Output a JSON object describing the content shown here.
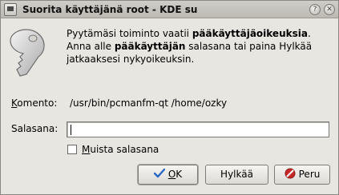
{
  "window": {
    "title": "Suorita käyttäjänä root - KDE su"
  },
  "titlebar": {
    "help_glyph": "?",
    "close_glyph": "✕"
  },
  "message": {
    "line1_pre": "Pyytämäsi toiminto vaatii ",
    "line1_bold": "pääkäyttäjäoikeuksia",
    "line1_post": ".",
    "line2_pre": "Anna alle ",
    "line2_bold": "pääkäyttäjän",
    "line2_post": " salasana tai paina Hylkää",
    "line3": "jatkaaksesi nykyoikeuksin."
  },
  "command": {
    "label_accel": "K",
    "label_rest": "omento:",
    "value": "/usr/bin/pcmanfm-qt /home/ozky"
  },
  "password": {
    "label": "Salasana:",
    "value": ""
  },
  "remember": {
    "label_accel": "M",
    "label_rest": "uista salasana",
    "checked": false
  },
  "buttons": {
    "ok_accel": "O",
    "ok_rest": "K",
    "hylkaa": "Hylkää",
    "peru": "Peru"
  },
  "colors": {
    "background": "#e8e6e1",
    "titlebar": "#c6c3bd",
    "ok_check": "#2a66c4",
    "cancel_red": "#c62828"
  }
}
